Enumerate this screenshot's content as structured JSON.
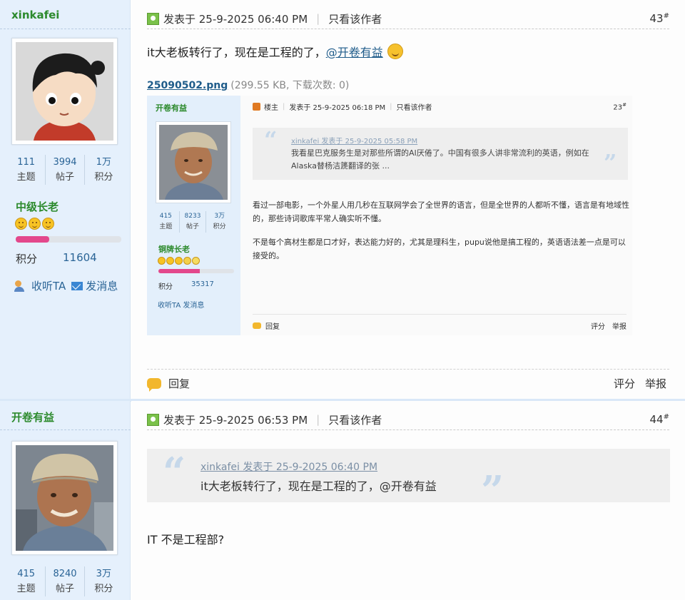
{
  "post1": {
    "author": {
      "name": "xinkafei",
      "stats": [
        {
          "num": "111",
          "label": "主题"
        },
        {
          "num": "3994",
          "label": "帖子"
        },
        {
          "num": "1万",
          "label": "积分"
        }
      ],
      "rank": "中级长老",
      "rank_progress": 0.32,
      "credit_label": "积分",
      "credit_value": "11604",
      "follow_label": "收听TA",
      "message_label": "发消息"
    },
    "header": {
      "posted": "发表于 25-9-2025 06:40 PM",
      "only_author": "只看该作者",
      "floor": "43",
      "floor_mark": "#"
    },
    "message_text": "it大老板转行了，现在是工程的了，",
    "mention": "@开卷有益",
    "attachment": {
      "filename": "25090502.png",
      "meta": "(299.55 KB, 下载次数: 0)"
    },
    "embedded": {
      "author": {
        "name": "开卷有益",
        "stats": [
          {
            "num": "415",
            "label": "主题"
          },
          {
            "num": "8233",
            "label": "帖子"
          },
          {
            "num": "3万",
            "label": "积分"
          }
        ],
        "rank": "铜牌长老",
        "rank_progress": 0.55,
        "credit_label": "积分",
        "credit_value": "35317",
        "actions": "收听TA  发消息"
      },
      "header": {
        "owner": "楼主",
        "posted": "发表于 25-9-2025 06:18 PM",
        "only_author": "只看该作者",
        "floor": "23"
      },
      "quote_head": "xinkafei 发表于 25-9-2025 05:58 PM",
      "quote_body": "我看星巴克服务生是对那些所谓的AI厌倦了。中国有很多人讲非常流利的英语，例如在Alaska替杨洁篪翻译的张 ...",
      "paragraphs": [
        "看过一部电影，一个外星人用几秒在互联网学会了全世界的语言，但是全世界的人都听不懂，语言是有地域性的，那些诗词歌库平常人确实听不懂。",
        "不是每个高材生都是口才好，表达能力好的，尤其是理科生，pupu说他是搞工程的，英语语法差一点是可以接受的。"
      ],
      "reply_label": "回复",
      "rate_label": "评分",
      "report_label": "举报"
    },
    "footer": {
      "reply_label": "回复",
      "rate_label": "评分",
      "report_label": "举报"
    }
  },
  "post2": {
    "author": {
      "name": "开卷有益",
      "stats": [
        {
          "num": "415",
          "label": "主题"
        },
        {
          "num": "8240",
          "label": "帖子"
        },
        {
          "num": "3万",
          "label": "积分"
        }
      ]
    },
    "header": {
      "posted": "发表于 25-9-2025 06:53 PM",
      "only_author": "只看该作者",
      "floor": "44",
      "floor_mark": "#"
    },
    "quote_head": "xinkafei 发表于 25-9-2025 06:40 PM",
    "quote_body": "it大老板转行了，现在是工程的了，@开卷有益",
    "message_text": "IT 不是工程部?"
  },
  "colors": {
    "sidebar_bg": "#e5f0fc",
    "username_green": "#2c8a2c",
    "link_blue": "#1f5c8a",
    "progress_pink": "#e3488c"
  }
}
